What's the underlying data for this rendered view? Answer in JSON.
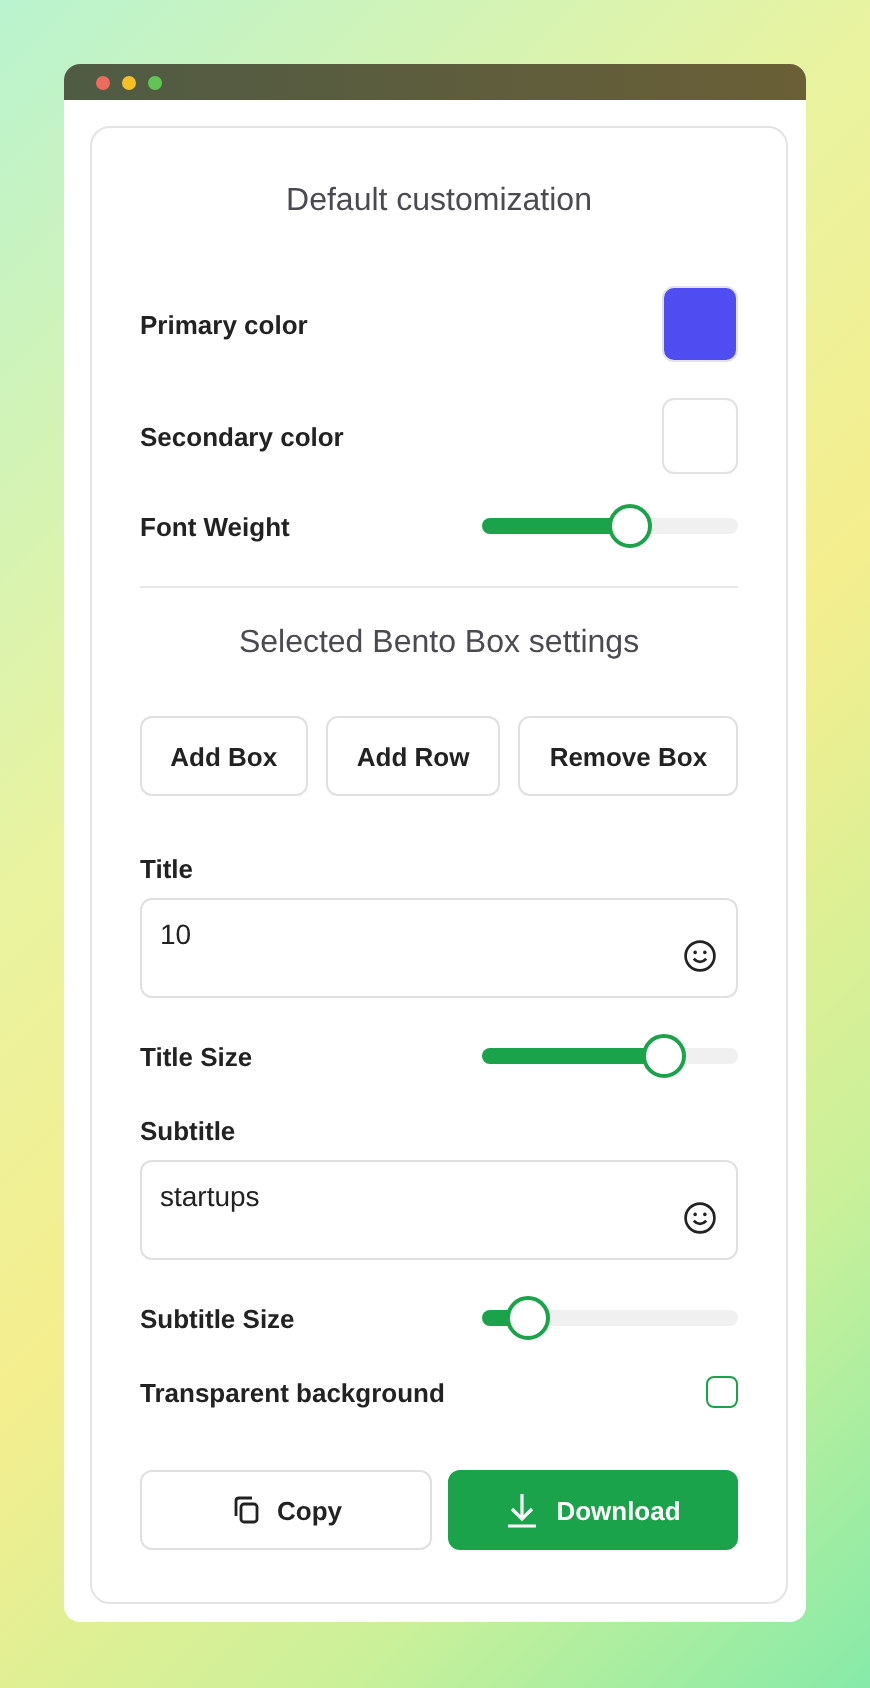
{
  "window": {
    "controls": [
      {
        "color": "#ec6a5e"
      },
      {
        "color": "#f4c025"
      },
      {
        "color": "#61c554"
      }
    ]
  },
  "default_section": {
    "heading": "Default customization",
    "rows": [
      {
        "kind": "swatch",
        "label": "Primary color",
        "color": "#4f4cf1"
      },
      {
        "kind": "swatch",
        "label": "Secondary color",
        "color": "#ffffff"
      },
      {
        "kind": "slider",
        "label": "Font Weight",
        "level": 0.58
      }
    ]
  },
  "box_section": {
    "heading": "Selected Bento Box settings",
    "buttons": [
      "Add Box",
      "Add Row",
      "Remove Box"
    ],
    "rows": [
      {
        "kind": "field",
        "label": "Title",
        "value": "10"
      },
      {
        "kind": "slider",
        "label": "Title Size",
        "level": 0.71
      },
      {
        "kind": "field",
        "label": "Subtitle",
        "value": "startups"
      },
      {
        "kind": "slider",
        "label": "Subtitle Size",
        "level": 0.18
      },
      {
        "kind": "checkbox",
        "label": "Transparent background",
        "checked": false
      }
    ]
  },
  "actions": [
    {
      "kind": "copy",
      "label": "Copy",
      "primary": false
    },
    {
      "kind": "download",
      "label": "Download",
      "primary": true
    }
  ]
}
